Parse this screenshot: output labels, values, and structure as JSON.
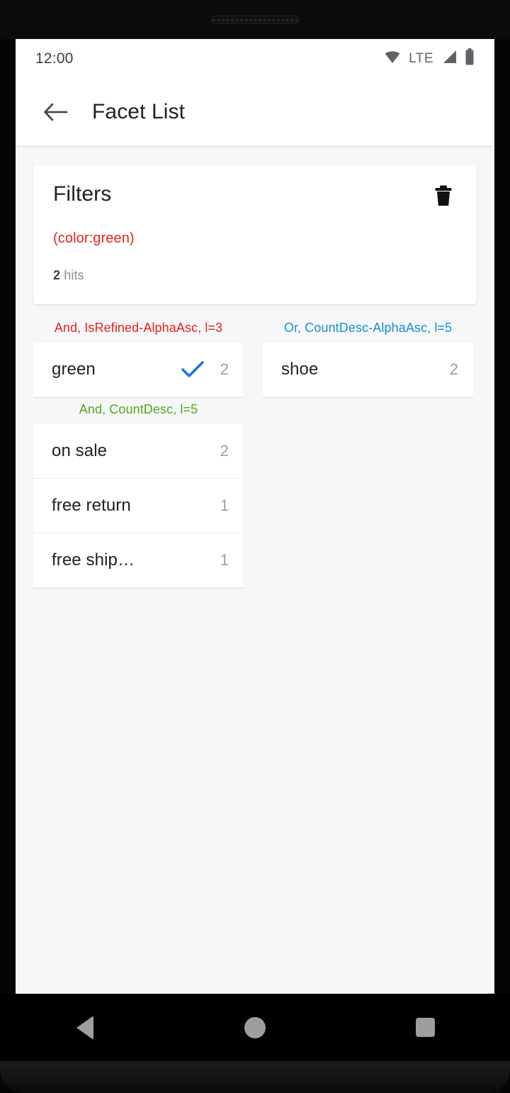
{
  "status_bar": {
    "time": "12:00",
    "network_label": "LTE",
    "icons": [
      "wifi-icon",
      "cellular-signal-icon",
      "battery-icon"
    ]
  },
  "app_bar": {
    "back_icon": "back-arrow-icon",
    "title": "Facet List"
  },
  "filters_card": {
    "title": "Filters",
    "clear_icon": "trash-icon",
    "expression": "(color:green)",
    "hits_count": "2",
    "hits_label": "hits",
    "expression_color": "#e8221d"
  },
  "facets": [
    {
      "header": "And, IsRefined-AlphaAsc, l=3",
      "header_color": "#e8221d",
      "column": "left",
      "items": [
        {
          "label": "green",
          "count": "2",
          "selected": true
        }
      ]
    },
    {
      "header": "Or, CountDesc-AlphaAsc, l=5",
      "header_color": "#1a8fd0",
      "column": "right",
      "items": [
        {
          "label": "shoe",
          "count": "2",
          "selected": false
        }
      ]
    },
    {
      "header": "And, CountDesc, l=5",
      "header_color": "#55a818",
      "column": "left",
      "items": [
        {
          "label": "on sale",
          "count": "2",
          "selected": false
        },
        {
          "label": "free return",
          "count": "1",
          "selected": false
        },
        {
          "label": "free ship…",
          "count": "1",
          "selected": false
        }
      ]
    }
  ],
  "checkmark_color": "#1a73e8",
  "nav_bar": {
    "back": "nav-back-icon",
    "home": "nav-home-icon",
    "recents": "nav-recents-icon"
  }
}
